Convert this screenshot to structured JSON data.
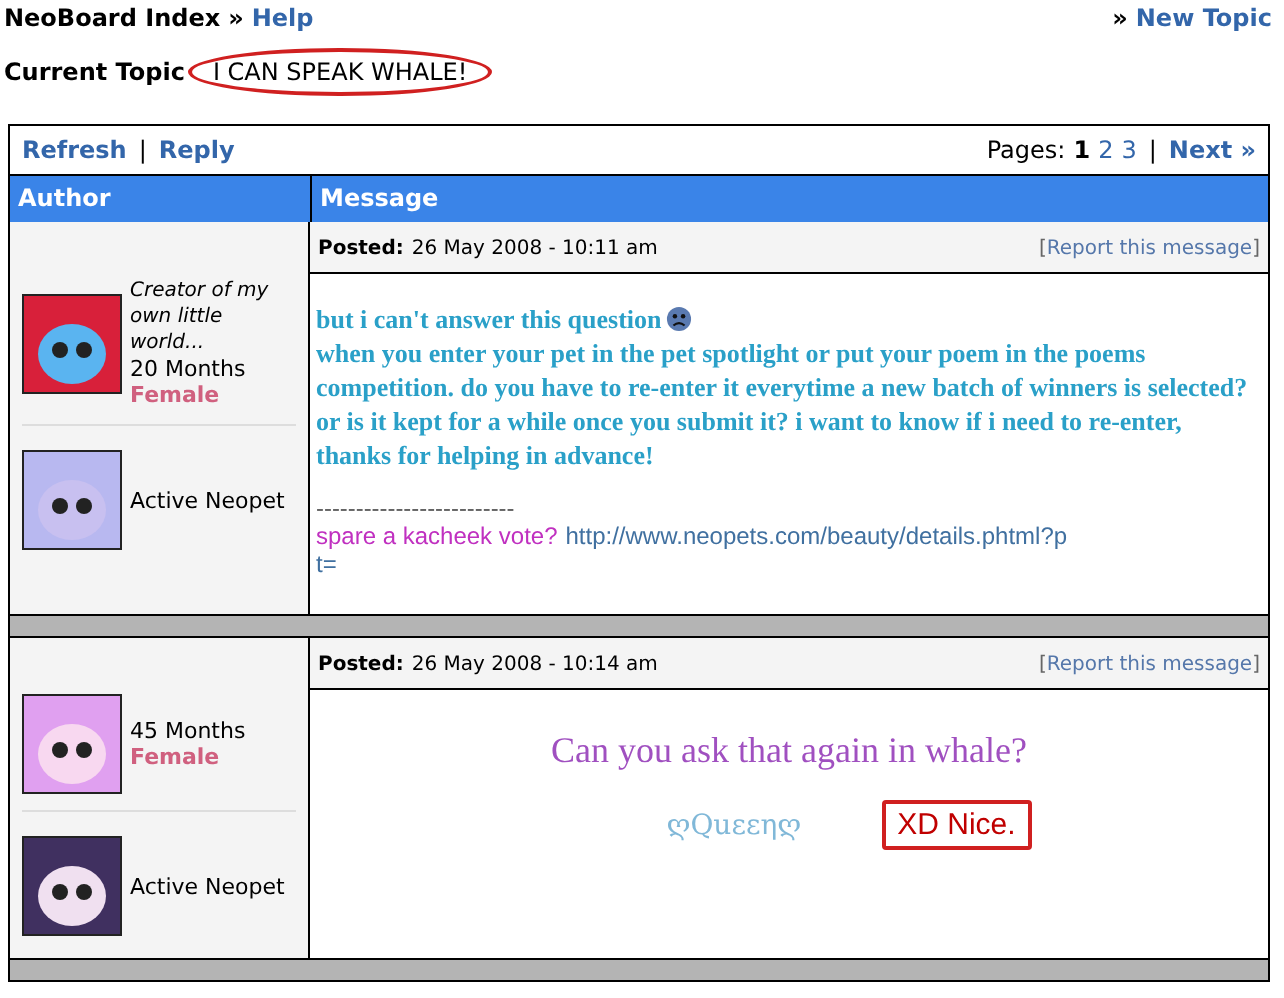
{
  "breadcrumb": {
    "root": "NeoBoard Index",
    "separator": "»",
    "current": "Help"
  },
  "new_topic": {
    "marker": "»",
    "label": "New Topic"
  },
  "current_topic": {
    "label": "Current Topic",
    "title": "I CAN SPEAK WHALE!"
  },
  "toolbar": {
    "actions": [
      "Refresh",
      "Reply"
    ],
    "divider": "|",
    "pages_label": "Pages:",
    "pages": [
      {
        "label": "1",
        "selected": true
      },
      {
        "label": "2",
        "selected": false
      },
      {
        "label": "3",
        "selected": false
      }
    ],
    "next_divider": "|",
    "next": "Next »"
  },
  "columns": [
    "Author",
    "Message"
  ],
  "posts": [
    {
      "author": {
        "title": "Creator of my own little world...",
        "age": "20 Months",
        "gender": "Female",
        "pet_status": "Active Neopet"
      },
      "posted_label": "Posted:",
      "posted": "26 May 2008 - 10:11 am",
      "report": {
        "open": "[",
        "label": "Report this message",
        "close": "]"
      },
      "kind": "question",
      "message": {
        "first_line": "but i can't answer this question",
        "body": "when you enter your pet in the pet spotlight or put your poem in the poems competition. do you have to re-enter it everytime a new batch of winners is selected? or is it kept for a while once you submit it? i want to know if i need to re-enter, thanks for helping in advance!"
      },
      "signature": {
        "rule": "-------------------------",
        "text": "spare a kacheek vote?",
        "link": "http://www.neopets.com/beauty/details.phtml?p",
        "link_cont": "t="
      }
    },
    {
      "author": {
        "age": "45 Months",
        "gender": "Female",
        "pet_status": "Active Neopet"
      },
      "posted_label": "Posted:",
      "posted": "26 May 2008 - 10:14 am",
      "report": {
        "open": "[",
        "label": "Report this message",
        "close": "]"
      },
      "kind": "reply",
      "message": {
        "quote": "Can you ask that again in whale?",
        "signature_name": "ღQuεεηღ",
        "note": "XD Nice."
      }
    }
  ]
}
